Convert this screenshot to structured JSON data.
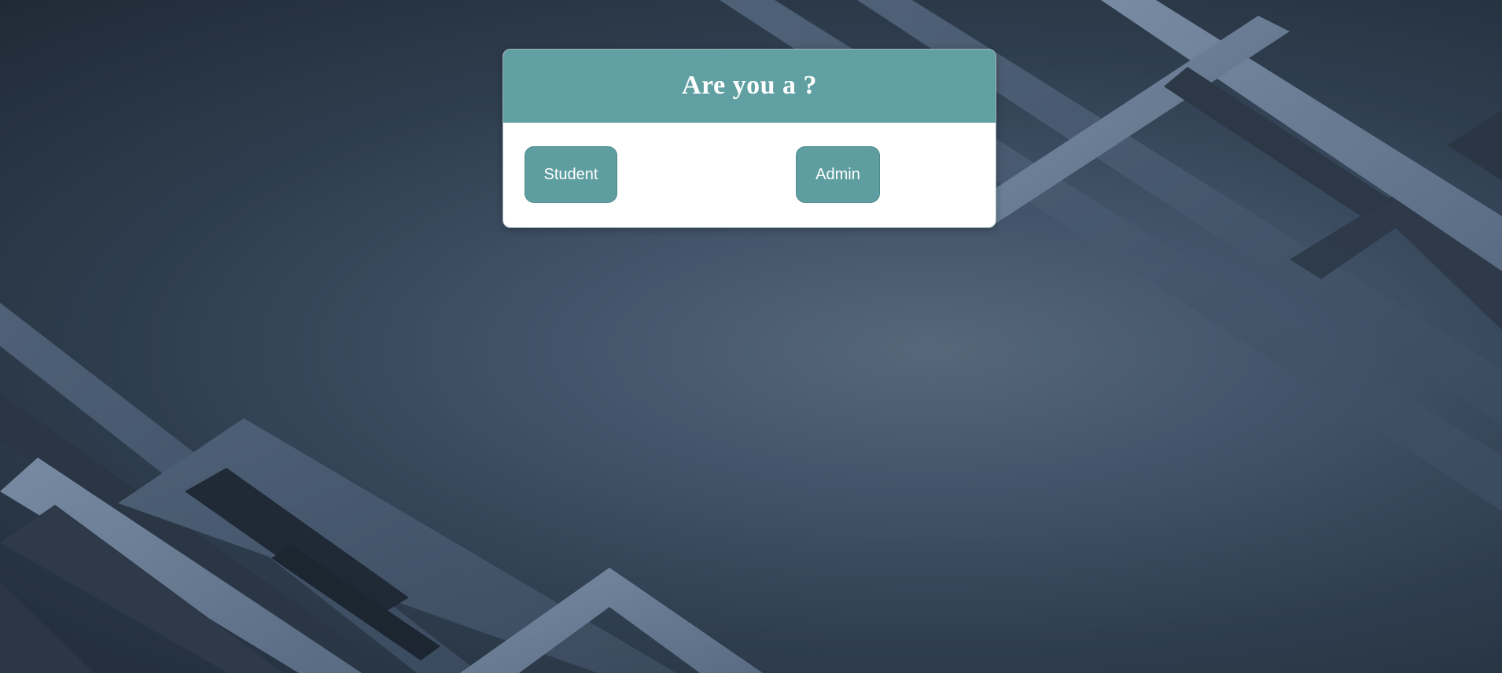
{
  "dialog": {
    "title": "Are you a ?",
    "buttons": {
      "student_label": "Student",
      "admin_label": "Admin"
    }
  },
  "colors": {
    "header": "#61a0a2",
    "button": "#5f9ea0",
    "card": "#ffffff",
    "background_dark": "#1f2a36",
    "background_light": "#56677a",
    "stripe": "#6b7f96"
  }
}
